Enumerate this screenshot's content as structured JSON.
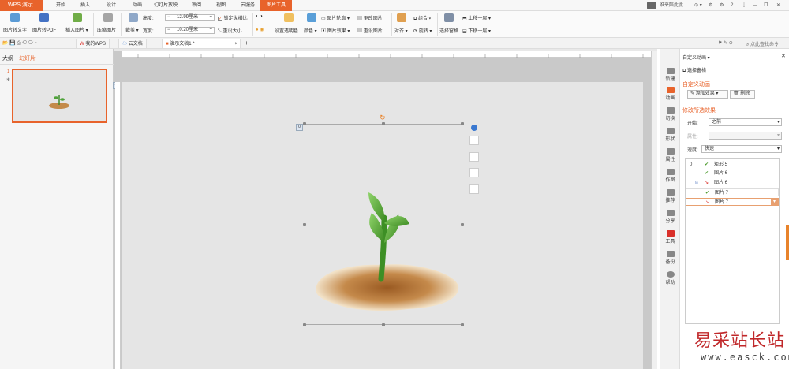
{
  "app": {
    "button": "WPS 演示",
    "user": "谁来陪此此",
    "colors": {
      "accent": "#e8632b",
      "accent_text": "#e8632b"
    }
  },
  "menu": [
    "开始",
    "插入",
    "设计",
    "动画",
    "幻灯片放映",
    "审阅",
    "视图",
    "云服务",
    "图片工具"
  ],
  "ribbon": {
    "pic_to_text": "图片转文字",
    "pic_to_pdf": "图片转PDF",
    "insert_pic": "插入图片",
    "compress": "压缩图片",
    "crop": "裁剪",
    "rotate": "旋转",
    "height_label": "高度:",
    "height_value": "12.99厘米",
    "width_label": "宽度:",
    "width_value": "10.20厘米",
    "lock_ratio": "锁定纵横比",
    "reset_size": "重设大小",
    "set_transparent": "设置透明色",
    "color": "颜色",
    "pic_outline": "图片轮廓",
    "pic_effect": "图片效果",
    "change_pic": "更改图片",
    "reset_pic": "重设图片",
    "align": "对齐",
    "group": "组合",
    "rotate2": "旋转",
    "select_pane": "选择窗格",
    "bring_forward": "上移一层",
    "send_backward": "下移一层"
  },
  "tabs": {
    "my_wps": "我的WPS",
    "cloud_doc": "云文档",
    "doc": "演示文稿1 *",
    "add": "+",
    "search_cmd": "点此查找命令"
  },
  "left_panel": {
    "tab_outline": "大纲",
    "tab_slides": "幻灯片",
    "slide_number": "1"
  },
  "sidebar": [
    "新建",
    "动画",
    "切换",
    "形状",
    "属性",
    "作图",
    "推荐",
    "分享",
    "工具",
    "备份",
    "帮助"
  ],
  "task_pane": {
    "title": "自定义动画",
    "select_pane": "选择窗格",
    "section": "自定义动画",
    "add_effect": "添加效果",
    "delete": "删除",
    "modify_section": "修改所选效果",
    "start_label": "开始:",
    "start_value": "之前",
    "property_label": "属性:",
    "property_value": "",
    "speed_label": "速度:",
    "speed_value": "快速",
    "effects": [
      {
        "order": "0",
        "name": "矩形 5"
      },
      {
        "order": "",
        "name": "图片 6"
      },
      {
        "order": "",
        "name": "图片 6"
      },
      {
        "order": "",
        "name": "图片 7"
      },
      {
        "order": "",
        "name": "图片 7"
      }
    ]
  },
  "watermark": {
    "line1": "易采站长站",
    "line2": "www.easck.com"
  }
}
